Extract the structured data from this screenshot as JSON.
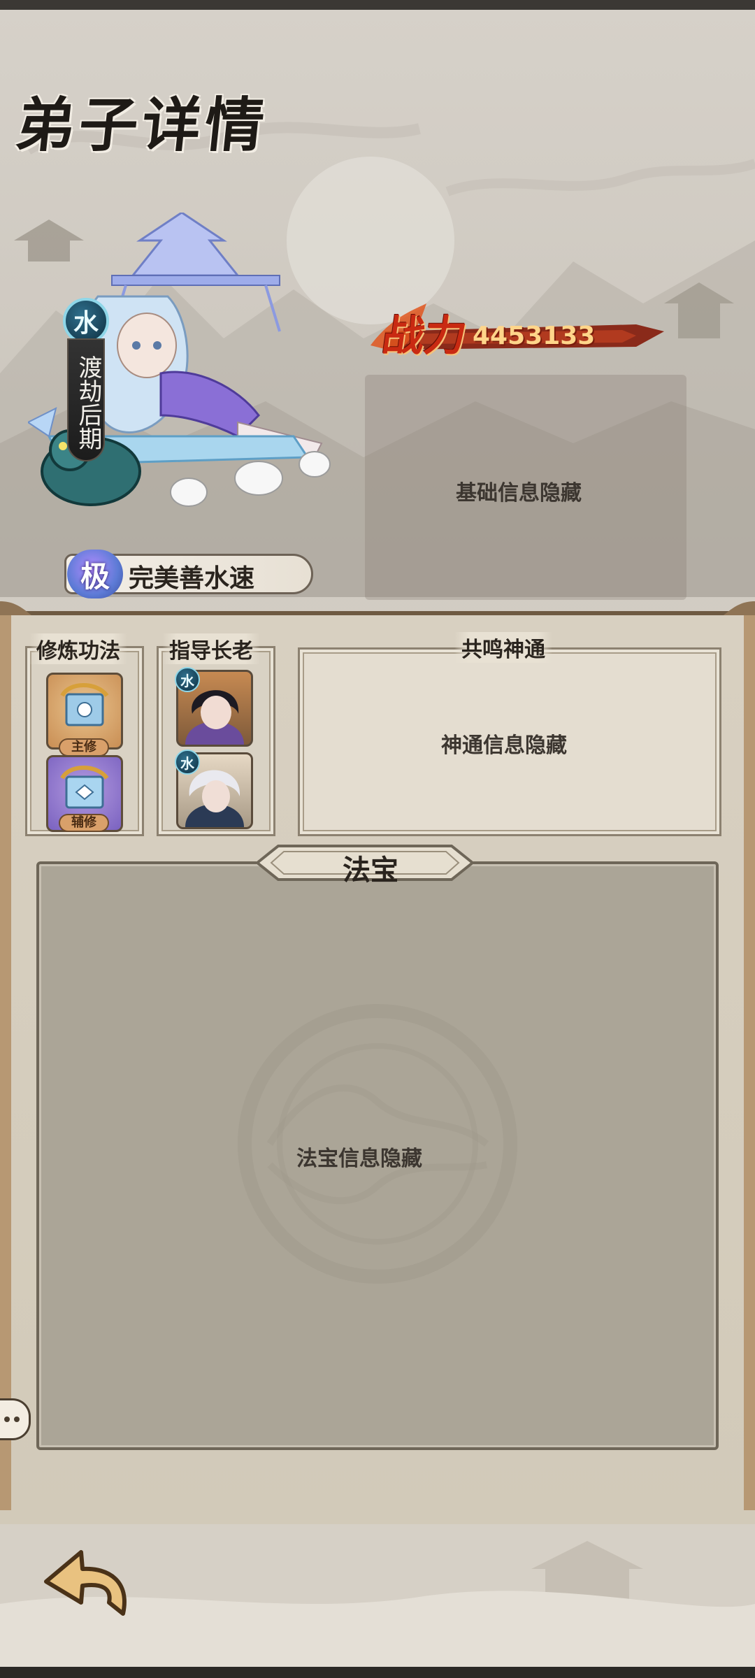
{
  "screen": {
    "title": "弟子详情"
  },
  "hero": {
    "element": "水",
    "realm": "渡劫后期",
    "rank_badge": "极",
    "rank_name": "完美善水速",
    "power_label": "战力",
    "power_value": "4453133",
    "basic_info_hidden": "基础信息隐藏"
  },
  "cultivation": {
    "label": "修炼功法",
    "main_tag": "主修",
    "aux_tag": "辅修"
  },
  "elders": {
    "label": "指导长老",
    "items": [
      {
        "element": "水"
      },
      {
        "element": "水"
      }
    ]
  },
  "resonance": {
    "label": "共鸣神通",
    "hidden_text": "神通信息隐藏"
  },
  "treasure": {
    "label": "法宝",
    "hidden_text": "法宝信息隐藏"
  },
  "colors": {
    "power_red": "#c92a12",
    "water_badge": "#2e6f8c",
    "frame_brown": "#b79873"
  },
  "icons": {
    "back": "back-arrow-icon",
    "chat": "chat-bubble-icon"
  }
}
